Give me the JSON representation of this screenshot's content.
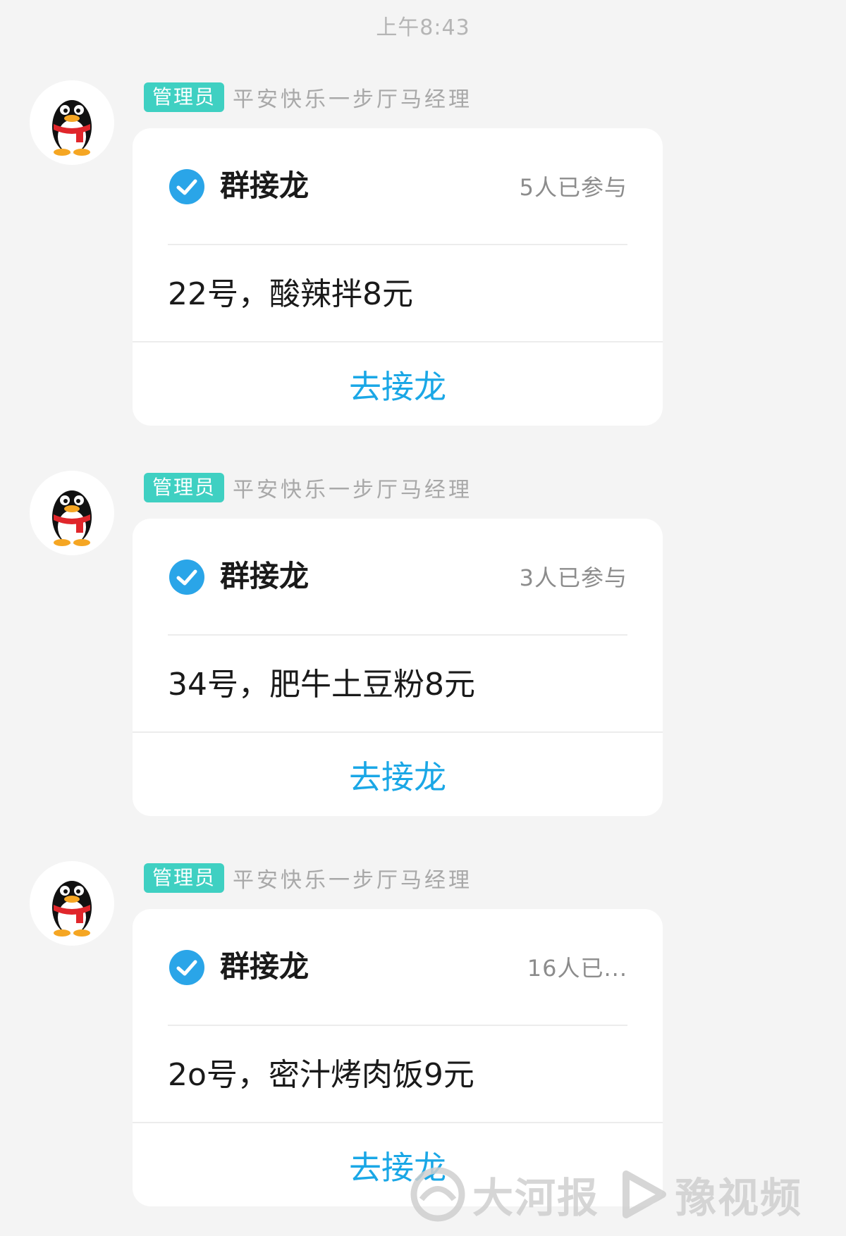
{
  "timestamp": "上午8:43",
  "messages": [
    {
      "role_badge": "管理员",
      "sender": "平安快乐一步厅马经理",
      "card_title": "群接龙",
      "participants": "5人已参与",
      "item": "22号，酸辣拌8元",
      "action_label": "去接龙"
    },
    {
      "role_badge": "管理员",
      "sender": "平安快乐一步厅马经理",
      "card_title": "群接龙",
      "participants": "3人已参与",
      "item": "34号，肥牛土豆粉8元",
      "action_label": "去接龙"
    },
    {
      "role_badge": "管理员",
      "sender": "平安快乐一步厅马经理",
      "card_title": "群接龙",
      "participants": "16人已...",
      "item": "2o号，密汁烤肉饭9元",
      "action_label": "去接龙"
    }
  ],
  "watermark": {
    "left_text": "大河报",
    "right_text": "豫视频"
  },
  "colors": {
    "background": "#f4f4f4",
    "badge": "#3fd0c2",
    "action": "#1aa7e6",
    "check": "#2aa5e8"
  },
  "icons": {
    "avatar": "qq-penguin-avatar",
    "check": "check-circle-icon"
  }
}
